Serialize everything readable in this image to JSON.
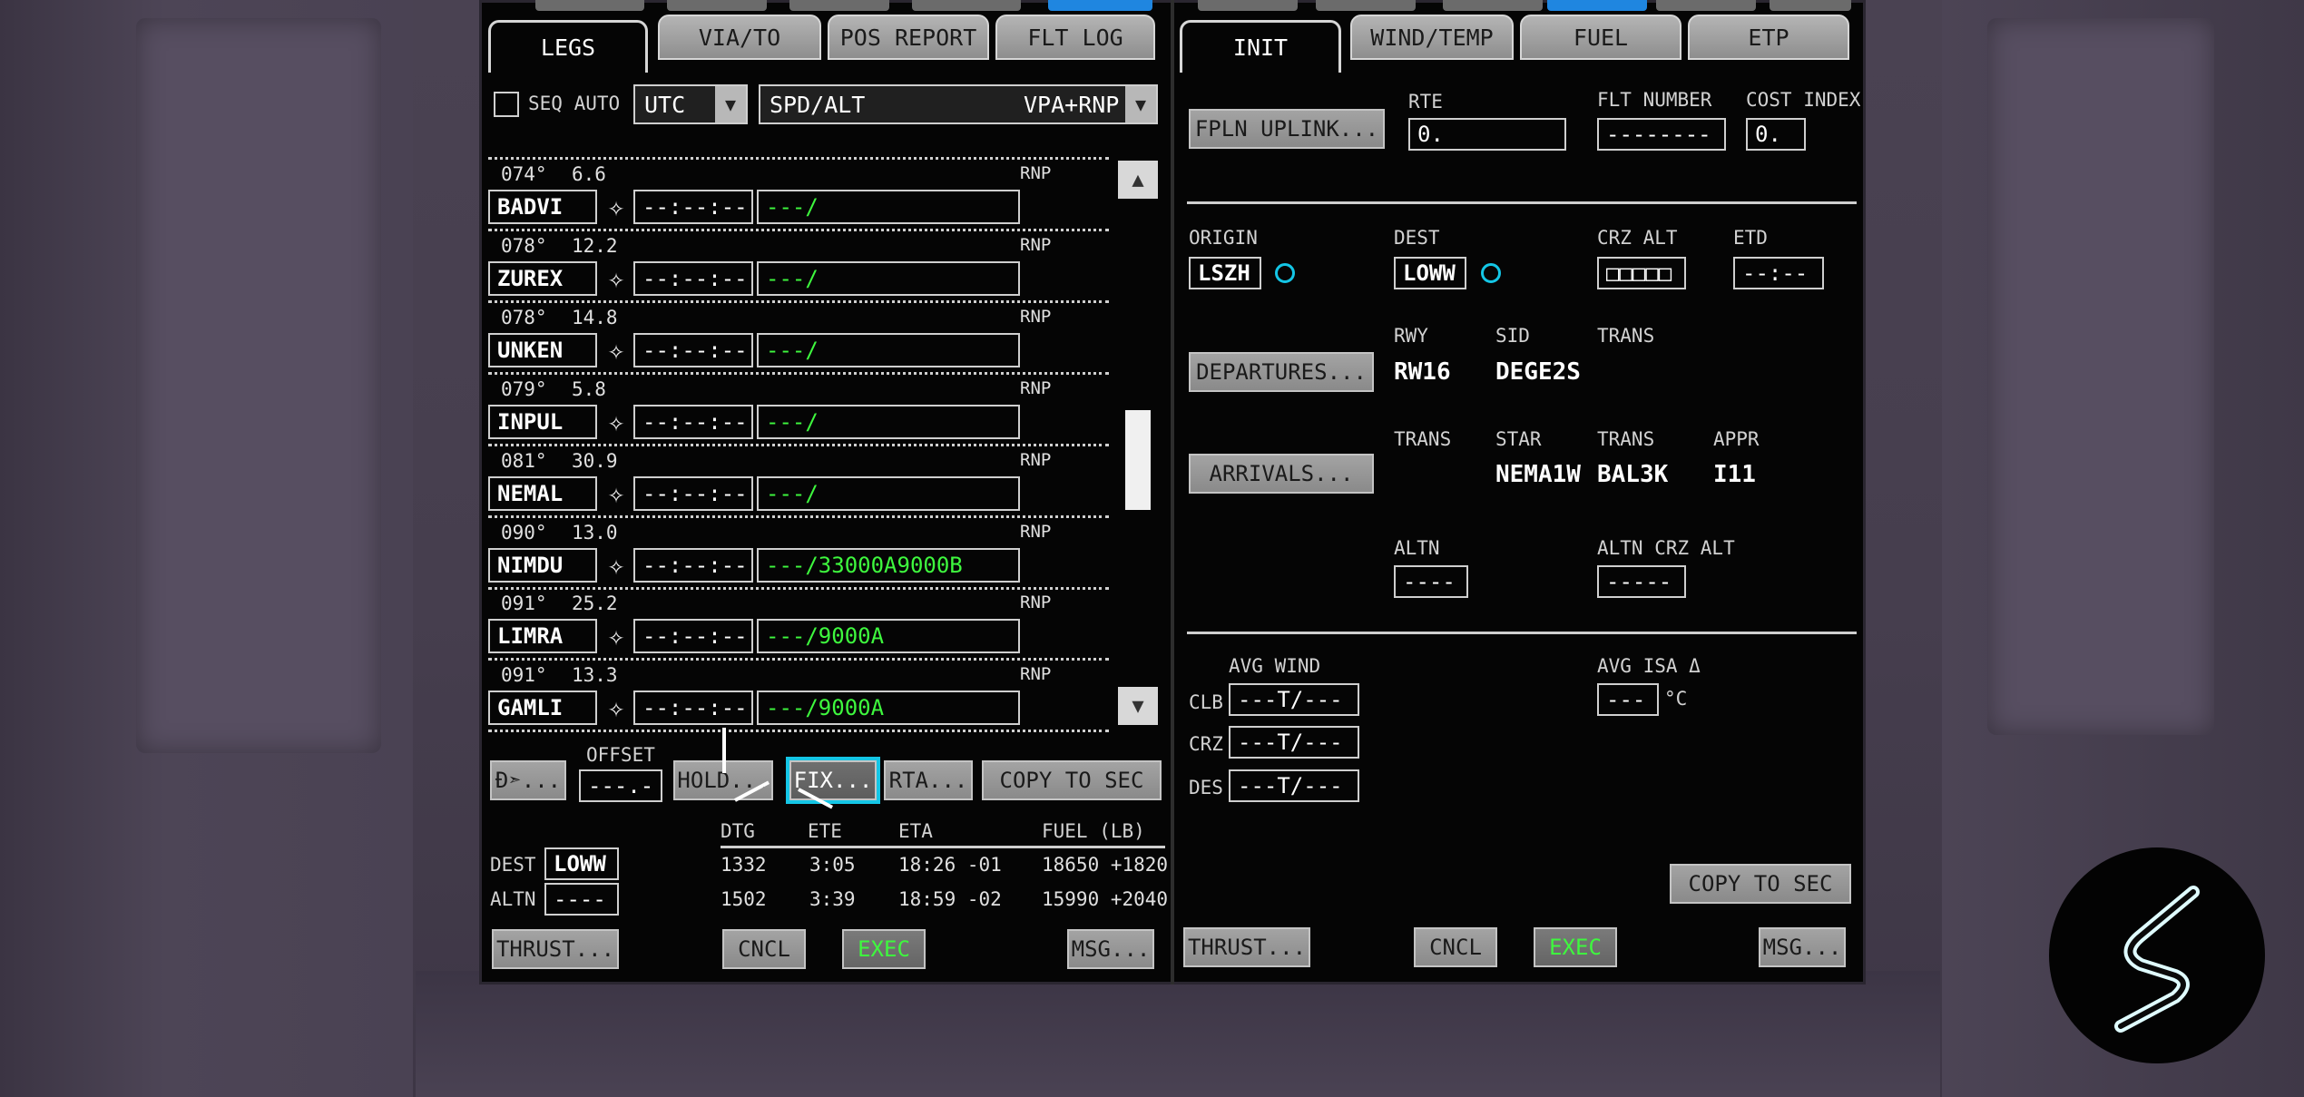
{
  "left": {
    "tabs": [
      "LEGS",
      "VIA/TO",
      "POS REPORT",
      "FLT LOG"
    ],
    "seq_auto_label": "SEQ AUTO",
    "time_select": "UTC",
    "mode_select_left": "SPD/ALT",
    "mode_select_right": "VPA+RNP",
    "legs": [
      {
        "course": "074°",
        "dist": "6.6",
        "rnp": "RNP",
        "fix": "BADVI",
        "time": "--:--:--",
        "constraint": "---/"
      },
      {
        "course": "078°",
        "dist": "12.2",
        "rnp": "RNP",
        "fix": "ZUREX",
        "time": "--:--:--",
        "constraint": "---/"
      },
      {
        "course": "078°",
        "dist": "14.8",
        "rnp": "RNP",
        "fix": "UNKEN",
        "time": "--:--:--",
        "constraint": "---/"
      },
      {
        "course": "079°",
        "dist": "5.8",
        "rnp": "RNP",
        "fix": "INPUL",
        "time": "--:--:--",
        "constraint": "---/"
      },
      {
        "course": "081°",
        "dist": "30.9",
        "rnp": "RNP",
        "fix": "NEMAL",
        "time": "--:--:--",
        "constraint": "---/"
      },
      {
        "course": "090°",
        "dist": "13.0",
        "rnp": "RNP",
        "fix": "NIMDU",
        "time": "--:--:--",
        "constraint": "---/33000A9000B"
      },
      {
        "course": "091°",
        "dist": "25.2",
        "rnp": "RNP",
        "fix": "LIMRA",
        "time": "--:--:--",
        "constraint": "---/9000A"
      },
      {
        "course": "091°",
        "dist": "13.3",
        "rnp": "RNP",
        "fix": "GAMLI",
        "time": "--:--:--",
        "constraint": "---/9000A"
      }
    ],
    "scroll_up": "▲",
    "scroll_down": "▼",
    "direct_btn": "Ð➣...",
    "offset_label": "OFFSET",
    "offset_value": "---.-",
    "hold_btn": "HOLD...",
    "fix_btn": "FIX...",
    "rta_btn": "RTA...",
    "copy_btn": "COPY TO SEC",
    "prog_headers": {
      "dtg": "DTG",
      "ete": "ETE",
      "eta": "ETA",
      "fuel": "FUEL (LB)"
    },
    "dest": {
      "label": "DEST",
      "value": "LOWW",
      "dtg": "1332",
      "ete": "3:05",
      "eta": "18:26 -01",
      "fuel": "18650 +1820"
    },
    "altn": {
      "label": "ALTN",
      "value": "----",
      "dtg": "1502",
      "ete": "3:39",
      "eta": "18:59 -02",
      "fuel": "15990 +2040"
    },
    "bottom": {
      "thrust": "THRUST...",
      "cncl": "CNCL",
      "exec": "EXEC",
      "msg": "MSG..."
    }
  },
  "right": {
    "tabs": [
      "INIT",
      "WIND/TEMP",
      "FUEL",
      "ETP"
    ],
    "fpln_uplink": "FPLN UPLINK...",
    "rte_label": "RTE",
    "rte_value": "0.",
    "flt_number_label": "FLT NUMBER",
    "flt_number_value": "--------",
    "cost_index_label": "COST INDEX",
    "cost_index_value": "0.",
    "origin_label": "ORIGIN",
    "origin_value": "LSZH",
    "dest_label": "DEST",
    "dest_value": "LOWW",
    "crz_alt_label": "CRZ ALT",
    "crz_alt_value": "□□□□□",
    "etd_label": "ETD",
    "etd_value": "--:--",
    "departures_btn": "DEPARTURES...",
    "rwy_label": "RWY",
    "rwy_value": "RW16",
    "sid_label": "SID",
    "sid_value": "DEGE2S",
    "trans_label": "TRANS",
    "arrivals_btn": "ARRIVALS...",
    "trans2_label": "TRANS",
    "star_label": "STAR",
    "star_value": "NEMA1W",
    "trans3_label": "TRANS",
    "trans3_value": "BAL3K",
    "appr_label": "APPR",
    "appr_value": "I11",
    "altn_label": "ALTN",
    "altn_value": "----",
    "altn_crz_alt_label": "ALTN CRZ ALT",
    "altn_crz_alt_value": "-----",
    "avg_wind_label": "AVG WIND",
    "avg_isa_label": "AVG ISA Δ",
    "avg_isa_value": "---",
    "avg_isa_unit": "°C",
    "winds": [
      {
        "phase": "CLB",
        "value": "---T/---"
      },
      {
        "phase": "CRZ",
        "value": "---T/---"
      },
      {
        "phase": "DES",
        "value": "---T/---"
      }
    ],
    "copy_btn": "COPY TO SEC",
    "bottom": {
      "thrust": "THRUST...",
      "cncl": "CNCL",
      "exec": "EXEC",
      "msg": "MSG..."
    }
  },
  "colors": {
    "accent": "#14c6e6",
    "green": "#3ef83e",
    "active_tab": "#1f86e0"
  }
}
